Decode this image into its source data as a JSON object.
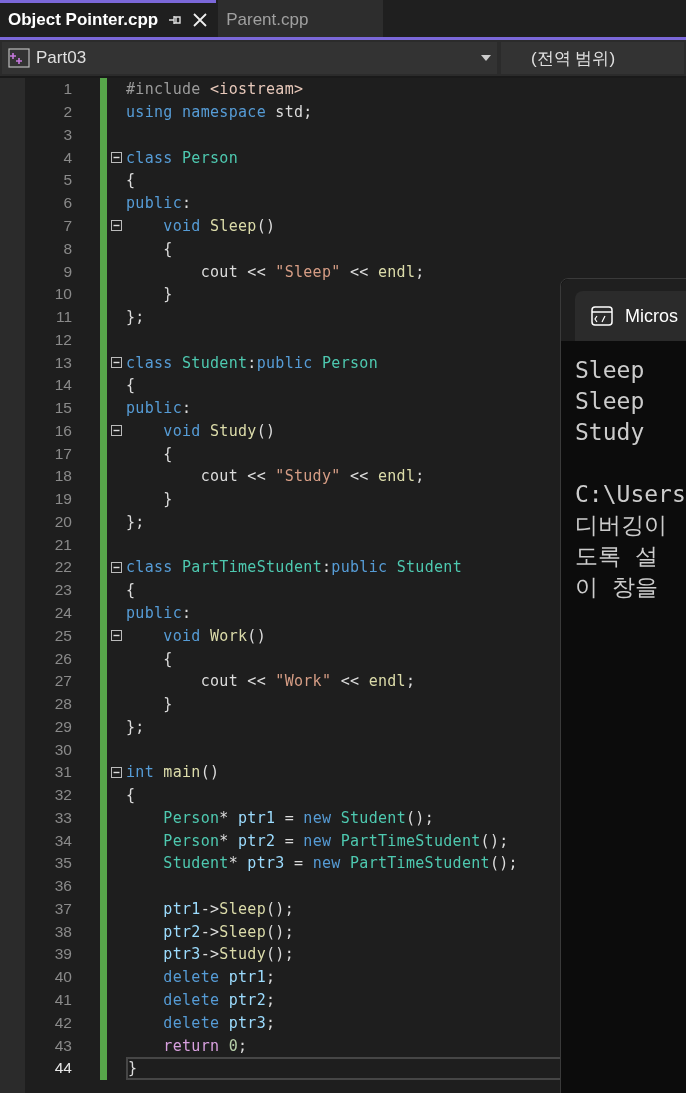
{
  "tabs": [
    {
      "label": "Object Pointer.cpp",
      "selected": true,
      "pinned": true,
      "closable": true
    },
    {
      "label": "Parent.cpp",
      "selected": false,
      "pinned": false,
      "closable": false
    }
  ],
  "navigation_bar": {
    "project": "Part03",
    "scope": "(전역 범위)"
  },
  "editor": {
    "lines": [
      {
        "number": "1",
        "fold": false,
        "current": false,
        "tokens": [
          {
            "kind": "pre",
            "text": "#include "
          },
          {
            "kind": "inc",
            "text": "<iostream>"
          }
        ]
      },
      {
        "number": "2",
        "fold": false,
        "current": false,
        "tokens": [
          {
            "kind": "kw",
            "text": "using "
          },
          {
            "kind": "kw",
            "text": "namespace "
          },
          {
            "kind": "p",
            "text": "std;"
          }
        ]
      },
      {
        "number": "3",
        "fold": false,
        "current": false
      },
      {
        "number": "4",
        "fold": true,
        "current": false,
        "tokens": [
          {
            "kind": "kw",
            "text": "class "
          },
          {
            "kind": "type",
            "text": "Person"
          }
        ]
      },
      {
        "number": "5",
        "fold": false,
        "current": false,
        "tokens": [
          {
            "kind": "p",
            "text": "{"
          }
        ]
      },
      {
        "number": "6",
        "fold": false,
        "current": false,
        "tokens": [
          {
            "kind": "kw",
            "text": "public"
          },
          {
            "kind": "p",
            "text": ":"
          }
        ]
      },
      {
        "number": "7",
        "fold": true,
        "current": false,
        "tokens": [
          {
            "kind": "kw",
            "text": "    void "
          },
          {
            "kind": "fn",
            "text": "Sleep"
          },
          {
            "kind": "p",
            "text": "()"
          }
        ]
      },
      {
        "number": "8",
        "fold": false,
        "current": false,
        "tokens": [
          {
            "kind": "p",
            "text": "    {"
          }
        ]
      },
      {
        "number": "9",
        "fold": false,
        "current": false,
        "tokens": [
          {
            "kind": "p",
            "text": "        cout << "
          },
          {
            "kind": "str",
            "text": "\"Sleep\""
          },
          {
            "kind": "p",
            "text": " << "
          },
          {
            "kind": "fn",
            "text": "endl"
          },
          {
            "kind": "p",
            "text": ";"
          }
        ]
      },
      {
        "number": "10",
        "fold": false,
        "current": false,
        "tokens": [
          {
            "kind": "p",
            "text": "    }"
          }
        ]
      },
      {
        "number": "11",
        "fold": false,
        "current": false,
        "tokens": [
          {
            "kind": "p",
            "text": "};"
          }
        ]
      },
      {
        "number": "12",
        "fold": false,
        "current": false
      },
      {
        "number": "13",
        "fold": true,
        "current": false,
        "tokens": [
          {
            "kind": "kw",
            "text": "class "
          },
          {
            "kind": "type",
            "text": "Student"
          },
          {
            "kind": "p",
            "text": ":"
          },
          {
            "kind": "kw",
            "text": "public "
          },
          {
            "kind": "type",
            "text": "Person"
          }
        ]
      },
      {
        "number": "14",
        "fold": false,
        "current": false,
        "tokens": [
          {
            "kind": "p",
            "text": "{"
          }
        ]
      },
      {
        "number": "15",
        "fold": false,
        "current": false,
        "tokens": [
          {
            "kind": "kw",
            "text": "public"
          },
          {
            "kind": "p",
            "text": ":"
          }
        ]
      },
      {
        "number": "16",
        "fold": true,
        "current": false,
        "tokens": [
          {
            "kind": "kw",
            "text": "    void "
          },
          {
            "kind": "fn",
            "text": "Study"
          },
          {
            "kind": "p",
            "text": "()"
          }
        ]
      },
      {
        "number": "17",
        "fold": false,
        "current": false,
        "tokens": [
          {
            "kind": "p",
            "text": "    {"
          }
        ]
      },
      {
        "number": "18",
        "fold": false,
        "current": false,
        "tokens": [
          {
            "kind": "p",
            "text": "        cout << "
          },
          {
            "kind": "str",
            "text": "\"Study\""
          },
          {
            "kind": "p",
            "text": " << "
          },
          {
            "kind": "fn",
            "text": "endl"
          },
          {
            "kind": "p",
            "text": ";"
          }
        ]
      },
      {
        "number": "19",
        "fold": false,
        "current": false,
        "tokens": [
          {
            "kind": "p",
            "text": "    }"
          }
        ]
      },
      {
        "number": "20",
        "fold": false,
        "current": false,
        "tokens": [
          {
            "kind": "p",
            "text": "};"
          }
        ]
      },
      {
        "number": "21",
        "fold": false,
        "current": false
      },
      {
        "number": "22",
        "fold": true,
        "current": false,
        "tokens": [
          {
            "kind": "kw",
            "text": "class "
          },
          {
            "kind": "type",
            "text": "PartTimeStudent"
          },
          {
            "kind": "p",
            "text": ":"
          },
          {
            "kind": "kw",
            "text": "public "
          },
          {
            "kind": "type",
            "text": "Student"
          }
        ]
      },
      {
        "number": "23",
        "fold": false,
        "current": false,
        "tokens": [
          {
            "kind": "p",
            "text": "{"
          }
        ]
      },
      {
        "number": "24",
        "fold": false,
        "current": false,
        "tokens": [
          {
            "kind": "kw",
            "text": "public"
          },
          {
            "kind": "p",
            "text": ":"
          }
        ]
      },
      {
        "number": "25",
        "fold": true,
        "current": false,
        "tokens": [
          {
            "kind": "kw",
            "text": "    void "
          },
          {
            "kind": "fn",
            "text": "Work"
          },
          {
            "kind": "p",
            "text": "()"
          }
        ]
      },
      {
        "number": "26",
        "fold": false,
        "current": false,
        "tokens": [
          {
            "kind": "p",
            "text": "    {"
          }
        ]
      },
      {
        "number": "27",
        "fold": false,
        "current": false,
        "tokens": [
          {
            "kind": "p",
            "text": "        cout << "
          },
          {
            "kind": "str",
            "text": "\"Work\""
          },
          {
            "kind": "p",
            "text": " << "
          },
          {
            "kind": "fn",
            "text": "endl"
          },
          {
            "kind": "p",
            "text": ";"
          }
        ]
      },
      {
        "number": "28",
        "fold": false,
        "current": false,
        "tokens": [
          {
            "kind": "p",
            "text": "    }"
          }
        ]
      },
      {
        "number": "29",
        "fold": false,
        "current": false,
        "tokens": [
          {
            "kind": "p",
            "text": "};"
          }
        ]
      },
      {
        "number": "30",
        "fold": false,
        "current": false
      },
      {
        "number": "31",
        "fold": true,
        "current": false,
        "tokens": [
          {
            "kind": "kw",
            "text": "int "
          },
          {
            "kind": "fn",
            "text": "main"
          },
          {
            "kind": "p",
            "text": "()"
          }
        ]
      },
      {
        "number": "32",
        "fold": false,
        "current": false,
        "tokens": [
          {
            "kind": "p",
            "text": "{"
          }
        ]
      },
      {
        "number": "33",
        "fold": false,
        "current": false,
        "tokens": [
          {
            "kind": "type",
            "text": "    Person"
          },
          {
            "kind": "p",
            "text": "* "
          },
          {
            "kind": "var",
            "text": "ptr1"
          },
          {
            "kind": "p",
            "text": " = "
          },
          {
            "kind": "kw",
            "text": "new "
          },
          {
            "kind": "type",
            "text": "Student"
          },
          {
            "kind": "p",
            "text": "();"
          }
        ]
      },
      {
        "number": "34",
        "fold": false,
        "current": false,
        "tokens": [
          {
            "kind": "type",
            "text": "    Person"
          },
          {
            "kind": "p",
            "text": "* "
          },
          {
            "kind": "var",
            "text": "ptr2"
          },
          {
            "kind": "p",
            "text": " = "
          },
          {
            "kind": "kw",
            "text": "new "
          },
          {
            "kind": "type",
            "text": "PartTimeStudent"
          },
          {
            "kind": "p",
            "text": "();"
          }
        ]
      },
      {
        "number": "35",
        "fold": false,
        "current": false,
        "tokens": [
          {
            "kind": "type",
            "text": "    Student"
          },
          {
            "kind": "p",
            "text": "* "
          },
          {
            "kind": "var",
            "text": "ptr3"
          },
          {
            "kind": "p",
            "text": " = "
          },
          {
            "kind": "kw",
            "text": "new "
          },
          {
            "kind": "type",
            "text": "PartTimeStudent"
          },
          {
            "kind": "p",
            "text": "();"
          }
        ]
      },
      {
        "number": "36",
        "fold": false,
        "current": false
      },
      {
        "number": "37",
        "fold": false,
        "current": false,
        "tokens": [
          {
            "kind": "var",
            "text": "    ptr1"
          },
          {
            "kind": "p",
            "text": "->"
          },
          {
            "kind": "fn",
            "text": "Sleep"
          },
          {
            "kind": "p",
            "text": "();"
          }
        ]
      },
      {
        "number": "38",
        "fold": false,
        "current": false,
        "tokens": [
          {
            "kind": "var",
            "text": "    ptr2"
          },
          {
            "kind": "p",
            "text": "->"
          },
          {
            "kind": "fn",
            "text": "Sleep"
          },
          {
            "kind": "p",
            "text": "();"
          }
        ]
      },
      {
        "number": "39",
        "fold": false,
        "current": false,
        "tokens": [
          {
            "kind": "var",
            "text": "    ptr3"
          },
          {
            "kind": "p",
            "text": "->"
          },
          {
            "kind": "fn",
            "text": "Study"
          },
          {
            "kind": "p",
            "text": "();"
          }
        ]
      },
      {
        "number": "40",
        "fold": false,
        "current": false,
        "tokens": [
          {
            "kind": "kw",
            "text": "    delete "
          },
          {
            "kind": "var",
            "text": "ptr1"
          },
          {
            "kind": "p",
            "text": ";"
          }
        ]
      },
      {
        "number": "41",
        "fold": false,
        "current": false,
        "tokens": [
          {
            "kind": "kw",
            "text": "    delete "
          },
          {
            "kind": "var",
            "text": "ptr2"
          },
          {
            "kind": "p",
            "text": ";"
          }
        ]
      },
      {
        "number": "42",
        "fold": false,
        "current": false,
        "tokens": [
          {
            "kind": "kw",
            "text": "    delete "
          },
          {
            "kind": "var",
            "text": "ptr3"
          },
          {
            "kind": "p",
            "text": ";"
          }
        ]
      },
      {
        "number": "43",
        "fold": false,
        "current": false,
        "tokens": [
          {
            "kind": "ctrl",
            "text": "    return "
          },
          {
            "kind": "num",
            "text": "0"
          },
          {
            "kind": "p",
            "text": ";"
          }
        ]
      },
      {
        "number": "44",
        "fold": false,
        "current": true,
        "tokens": [
          {
            "kind": "p",
            "text": "}"
          }
        ]
      }
    ]
  },
  "console": {
    "title": "Micros",
    "output": [
      "Sleep",
      "Sleep",
      "Study"
    ],
    "messages": [
      "C:\\Users",
      "디버깅이",
      "도록 설",
      "이 창을"
    ]
  }
}
